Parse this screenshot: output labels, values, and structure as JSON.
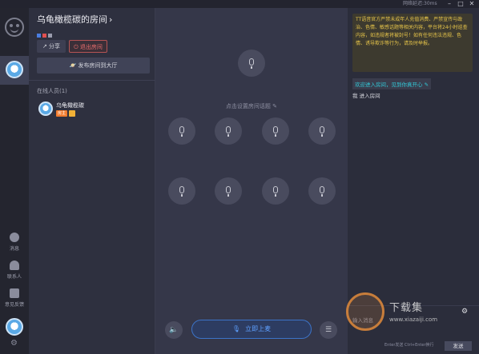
{
  "window": {
    "status": "网络延迟:30ms",
    "min": "–",
    "max": "□",
    "close": "✕"
  },
  "rail": {
    "messages": "消息",
    "contacts": "联系人",
    "feedback": "意见反馈"
  },
  "room": {
    "title": "乌龟橄榄碳的房间",
    "share": "分享",
    "exit": "退出房间",
    "publish": "发布房间到大厅",
    "online_label": "在线人员(1)",
    "member": {
      "name": "乌龟橄榄碳",
      "badge": "房主"
    }
  },
  "stage": {
    "topic": "点击设置房间话题",
    "go_mic": "立即上麦",
    "speaker_icon": "speaker-icon",
    "menu_icon": "menu-icon"
  },
  "chat": {
    "notice": "TT语音官方严禁未成年人充值消费、严禁宣传与政治、色情、敏感话题等相关内容，平台将24小时巡查内容，如违规者将被封号！如有任何违法违规、色情、诱导欺诈等行为，请及时举报。",
    "welcome": "欢迎进入房间，见到你真开心",
    "entered": "我 进入房间",
    "input_placeholder": "输入消息",
    "hint": "Enter发送 Ctrl+Enter换行",
    "send": "发送"
  },
  "watermark": {
    "text": "下载集",
    "url": "www.xiazaiji.com"
  },
  "colors": {
    "accent": "#5ea0ff",
    "notice": "#e8c64a",
    "welcome": "#32c9d8",
    "danger": "#e86d6d"
  }
}
